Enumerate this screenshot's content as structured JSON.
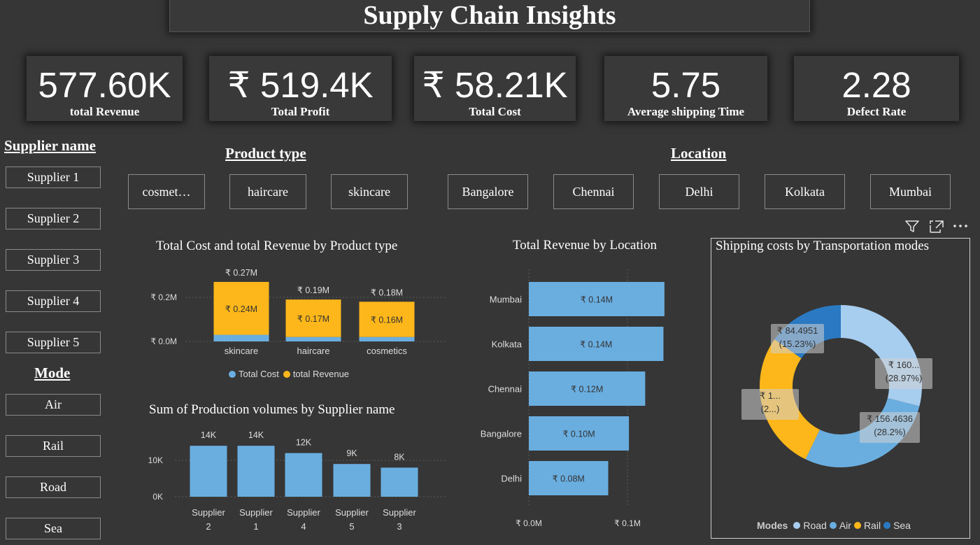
{
  "title": "Supply Chain Insights",
  "kpis": [
    {
      "value": "577.60K",
      "label": "total Revenue"
    },
    {
      "value": "₹ 519.4K",
      "label": "Total Profit"
    },
    {
      "value": "₹ 58.21K",
      "label": "Total Cost"
    },
    {
      "value": "5.75",
      "label": "Average shipping Time"
    },
    {
      "value": "2.28",
      "label": "Defect Rate"
    }
  ],
  "supplier": {
    "heading": "Supplier name",
    "items": [
      "Supplier 1",
      "Supplier 2",
      "Supplier 3",
      "Supplier 4",
      "Supplier 5"
    ]
  },
  "mode": {
    "heading": "Mode",
    "items": [
      "Air",
      "Rail",
      "Road",
      "Sea"
    ]
  },
  "product_type": {
    "heading": "Product type",
    "items": [
      "cosmet…",
      "haircare",
      "skincare"
    ]
  },
  "location": {
    "heading": "Location",
    "items": [
      "Bangalore",
      "Chennai",
      "Delhi",
      "Kolkata",
      "Mumbai"
    ]
  },
  "colors": {
    "background": "#363636",
    "cost_blue": "#6aaee0",
    "revenue_yellow": "#fdb71a",
    "road": "#a7cdef",
    "air": "#6aaee0",
    "rail": "#fdb71a",
    "sea": "#2a79c2"
  },
  "chart_data": [
    {
      "type": "bar",
      "title": "Total Cost and total Revenue by Product type",
      "categories": [
        "skincare",
        "haircare",
        "cosmetics"
      ],
      "series": [
        {
          "name": "Total Cost",
          "values": [
            0.03,
            0.02,
            0.02
          ]
        },
        {
          "name": "total Revenue",
          "values": [
            0.24,
            0.17,
            0.16
          ]
        }
      ],
      "segment_labels": [
        "₹ 0.24M",
        "₹ 0.17M",
        "₹ 0.16M"
      ],
      "total_labels": [
        "₹ 0.27M",
        "₹ 0.19M",
        "₹ 0.18M"
      ],
      "yticks": [
        "₹ 0.0M",
        "₹ 0.2M"
      ],
      "ylim": [
        0,
        0.3
      ],
      "legend": "bottom"
    },
    {
      "type": "bar",
      "title": "Sum of Production volumes by Supplier name",
      "categories": [
        [
          "Supplier",
          "2"
        ],
        [
          "Supplier",
          "1"
        ],
        [
          "Supplier",
          "4"
        ],
        [
          "Supplier",
          "5"
        ],
        [
          "Supplier",
          "3"
        ]
      ],
      "values": [
        14,
        14,
        12,
        9,
        8
      ],
      "value_labels": [
        "14K",
        "14K",
        "12K",
        "9K",
        "8K"
      ],
      "yticks": [
        "0K",
        "10K"
      ],
      "ylim": [
        0,
        16
      ]
    },
    {
      "type": "bar",
      "orientation": "horizontal",
      "title": "Total Revenue by Location",
      "categories": [
        "Mumbai",
        "Kolkata",
        "Chennai",
        "Bangalore",
        "Delhi"
      ],
      "values": [
        0.14,
        0.14,
        0.12,
        0.1,
        0.08
      ],
      "value_labels": [
        "₹ 0.14M",
        "₹ 0.14M",
        "₹ 0.12M",
        "₹ 0.10M",
        "₹ 0.08M"
      ],
      "xticks": [
        "₹ 0.0M",
        "₹ 0.1M"
      ],
      "xlim": [
        0,
        0.15
      ]
    },
    {
      "type": "pie",
      "donut": true,
      "title": "Shipping costs by Transportation modes",
      "legend_title": "Modes",
      "slices": [
        {
          "name": "Road",
          "percent": 28.97,
          "label": "₹ 160...",
          "pct_label": "(28.97%)"
        },
        {
          "name": "Air",
          "percent": 28.2,
          "label": "₹ 156.4636",
          "pct_label": "(28.2%)"
        },
        {
          "name": "Rail",
          "percent": 27.6,
          "label": "₹ 1...",
          "pct_label": "(2...)"
        },
        {
          "name": "Sea",
          "percent": 15.23,
          "label": "₹ 84.4951",
          "pct_label": "(15.23%)"
        }
      ],
      "legend": "bottom"
    }
  ]
}
